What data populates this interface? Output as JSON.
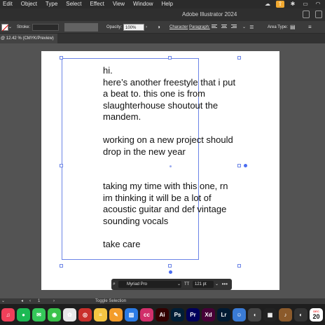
{
  "menubar": {
    "items": [
      "Edit",
      "Object",
      "Type",
      "Select",
      "Effect",
      "View",
      "Window",
      "Help"
    ]
  },
  "window": {
    "title": "Adobe Illustrator 2024"
  },
  "control_bar": {
    "stroke_label": "Stroke:",
    "opacity_label": "Opacity:",
    "opacity_value": "100%",
    "character_label": "Character",
    "paragraph_label": "Paragraph:",
    "area_type_label": "Area Type:"
  },
  "document_tab": {
    "label": "@ 12.42 % (CMYK/Preview)"
  },
  "text_content": {
    "lines_a": [
      "hi.",
      "here’s another freestyle that i put",
      "a beat to. this one is from",
      "slaughterhouse shoutout the",
      "mandem."
    ],
    "lines_b": [
      "working on a new project should",
      "drop in the new year"
    ],
    "lines_c": [
      "taking my time with this one, rn",
      "im thinking it will be a lot of",
      "acoustic guitar and def vintage",
      "sounding vocals"
    ],
    "lines_d": [
      "take care"
    ]
  },
  "context_bar": {
    "font_name": "Myriad Pro",
    "font_size": "121 pt",
    "more": "•••"
  },
  "status_bar": {
    "page_num": "1",
    "tool_label": "Toggle Selection"
  },
  "dock": {
    "calendar_month": "DEC",
    "calendar_day": "20",
    "apps": [
      {
        "name": "Music",
        "label": "♫",
        "color": "#f0405a"
      },
      {
        "name": "Spotify",
        "label": "●",
        "color": "#1db954"
      },
      {
        "name": "Messages",
        "label": "✉",
        "color": "#34c759"
      },
      {
        "name": "FaceTime",
        "label": "◉",
        "color": "#3ac24a"
      },
      {
        "name": "Photos",
        "label": "✿",
        "color": "#e8e8e8"
      },
      {
        "name": "Photo Booth",
        "label": "◎",
        "color": "#c9302c"
      },
      {
        "name": "Notes",
        "label": "≡",
        "color": "#f5c542"
      },
      {
        "name": "Pages",
        "label": "✎",
        "color": "#f39c2a"
      },
      {
        "name": "Numbers",
        "label": "▥",
        "color": "#2b7be4"
      },
      {
        "name": "Creative Cloud",
        "label": "cc",
        "color": "#d12f6a"
      },
      {
        "name": "Illustrator",
        "label": "Ai",
        "color": "#330000"
      },
      {
        "name": "Photoshop",
        "label": "Ps",
        "color": "#001e36"
      },
      {
        "name": "Premiere",
        "label": "Pr",
        "color": "#00005b"
      },
      {
        "name": "Adobe XD",
        "label": "Xd",
        "color": "#470137"
      },
      {
        "name": "Lightroom",
        "label": "Lr",
        "color": "#001a33"
      },
      {
        "name": "Finder",
        "label": "☺",
        "color": "#3a7bd5"
      },
      {
        "name": "Audio",
        "label": "◖",
        "color": "#444444"
      },
      {
        "name": "Soundboard",
        "label": "▦",
        "color": "#222222"
      },
      {
        "name": "Guitar",
        "label": "♪",
        "color": "#8b5a2b"
      },
      {
        "name": "Logic",
        "label": "◐",
        "color": "#333333"
      }
    ]
  },
  "colors": {
    "selection": "#6b84e6",
    "artboard": "#ffffff",
    "canvas": "#535353"
  }
}
